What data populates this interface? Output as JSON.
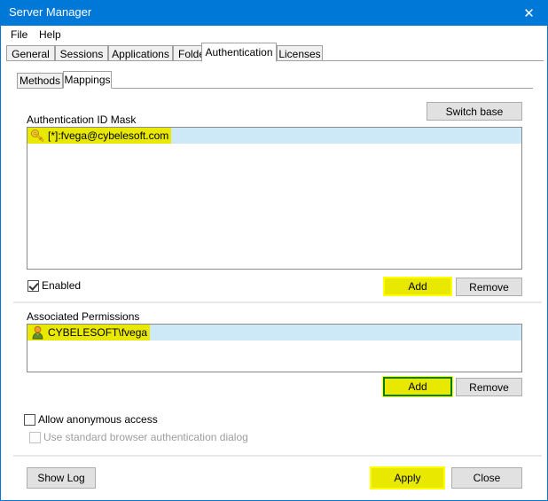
{
  "window": {
    "title": "Server Manager",
    "close_icon": "close-icon",
    "close_glyph": "✕",
    "accent_color": "#0078d7"
  },
  "menubar": {
    "items": [
      {
        "label": "File"
      },
      {
        "label": "Help"
      }
    ]
  },
  "outer_tabs": {
    "selected": "Authentication",
    "items": [
      {
        "label": "General"
      },
      {
        "label": "Sessions"
      },
      {
        "label": "Applications"
      },
      {
        "label": "Folders"
      },
      {
        "label": "Authentication"
      },
      {
        "label": "Licenses"
      }
    ]
  },
  "inner_tabs": {
    "selected": "Mappings",
    "items": [
      {
        "label": "Methods"
      },
      {
        "label": "Mappings"
      }
    ]
  },
  "mappings": {
    "switch_base_label": "Switch base",
    "auth_id_mask_label": "Authentication ID Mask",
    "auth_id_mask_items": [
      {
        "icon": "key-icon",
        "text": "[*]:fvega@cybelesoft.com",
        "selected": true,
        "highlighted": true
      }
    ],
    "enabled_checkbox": {
      "label": "Enabled",
      "checked": true,
      "disabled": false
    },
    "mask_add_label": "Add",
    "mask_remove_label": "Remove",
    "associated_permissions_label": "Associated Permissions",
    "associated_permissions_items": [
      {
        "icon": "user-icon",
        "text": "CYBELESOFT\\fvega",
        "selected": true,
        "highlighted": true
      }
    ],
    "perm_add_label": "Add",
    "perm_remove_label": "Remove",
    "allow_anonymous_checkbox": {
      "label": "Allow anonymous access",
      "checked": false,
      "disabled": false
    },
    "browser_auth_checkbox": {
      "label": "Use standard browser authentication dialog",
      "checked": false,
      "disabled": true
    }
  },
  "footer": {
    "show_log_label": "Show Log",
    "apply_label": "Apply",
    "close_label": "Close"
  },
  "highlights": {
    "yellow_fill": "#e8e800",
    "yellow_border": "#ffff00",
    "green_border": "#008000",
    "selection_blue": "#cde8f7"
  }
}
